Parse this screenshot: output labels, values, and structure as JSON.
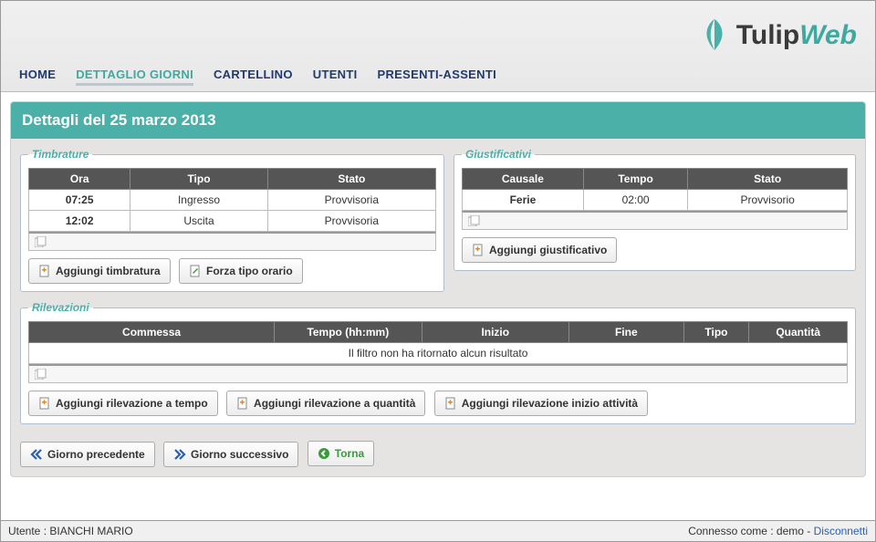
{
  "brand": {
    "name": "Tulip",
    "suffix": "Web"
  },
  "nav": {
    "home": "HOME",
    "dettaglio": "DETTAGLIO GIORNI",
    "cartellino": "CARTELLINO",
    "utenti": "UTENTI",
    "presenti": "PRESENTI-ASSENTI"
  },
  "page": {
    "title": "Dettagli del 25 marzo 2013"
  },
  "timbrature": {
    "legend": "Timbrature",
    "headers": {
      "ora": "Ora",
      "tipo": "Tipo",
      "stato": "Stato"
    },
    "rows": [
      {
        "ora": "07:25",
        "tipo": "Ingresso",
        "stato": "Provvisoria"
      },
      {
        "ora": "12:02",
        "tipo": "Uscita",
        "stato": "Provvisoria"
      }
    ],
    "add_btn": "Aggiungi timbratura",
    "forza_btn": "Forza tipo orario"
  },
  "giustificativi": {
    "legend": "Giustificativi",
    "headers": {
      "causale": "Causale",
      "tempo": "Tempo",
      "stato": "Stato"
    },
    "rows": [
      {
        "causale": "Ferie",
        "tempo": "02:00",
        "stato": "Provvisorio"
      }
    ],
    "add_btn": "Aggiungi giustificativo"
  },
  "rilevazioni": {
    "legend": "Rilevazioni",
    "headers": {
      "commessa": "Commessa",
      "tempo": "Tempo (hh:mm)",
      "inizio": "Inizio",
      "fine": "Fine",
      "tipo": "Tipo",
      "quantita": "Quantità"
    },
    "empty": "Il filtro non ha ritornato alcun risultato",
    "btn_tempo": "Aggiungi rilevazione a tempo",
    "btn_quantita": "Aggiungi rilevazione a quantità",
    "btn_inizio": "Aggiungi rilevazione inizio attività"
  },
  "navbuttons": {
    "prev": "Giorno precedente",
    "next": "Giorno successivo",
    "back": "Torna"
  },
  "footer": {
    "user_label": "Utente : ",
    "user_name": "BIANCHI MARIO",
    "conn_label": "Connesso come : ",
    "conn_user": "demo",
    "separator": " - ",
    "disconnect": "Disconnetti"
  }
}
